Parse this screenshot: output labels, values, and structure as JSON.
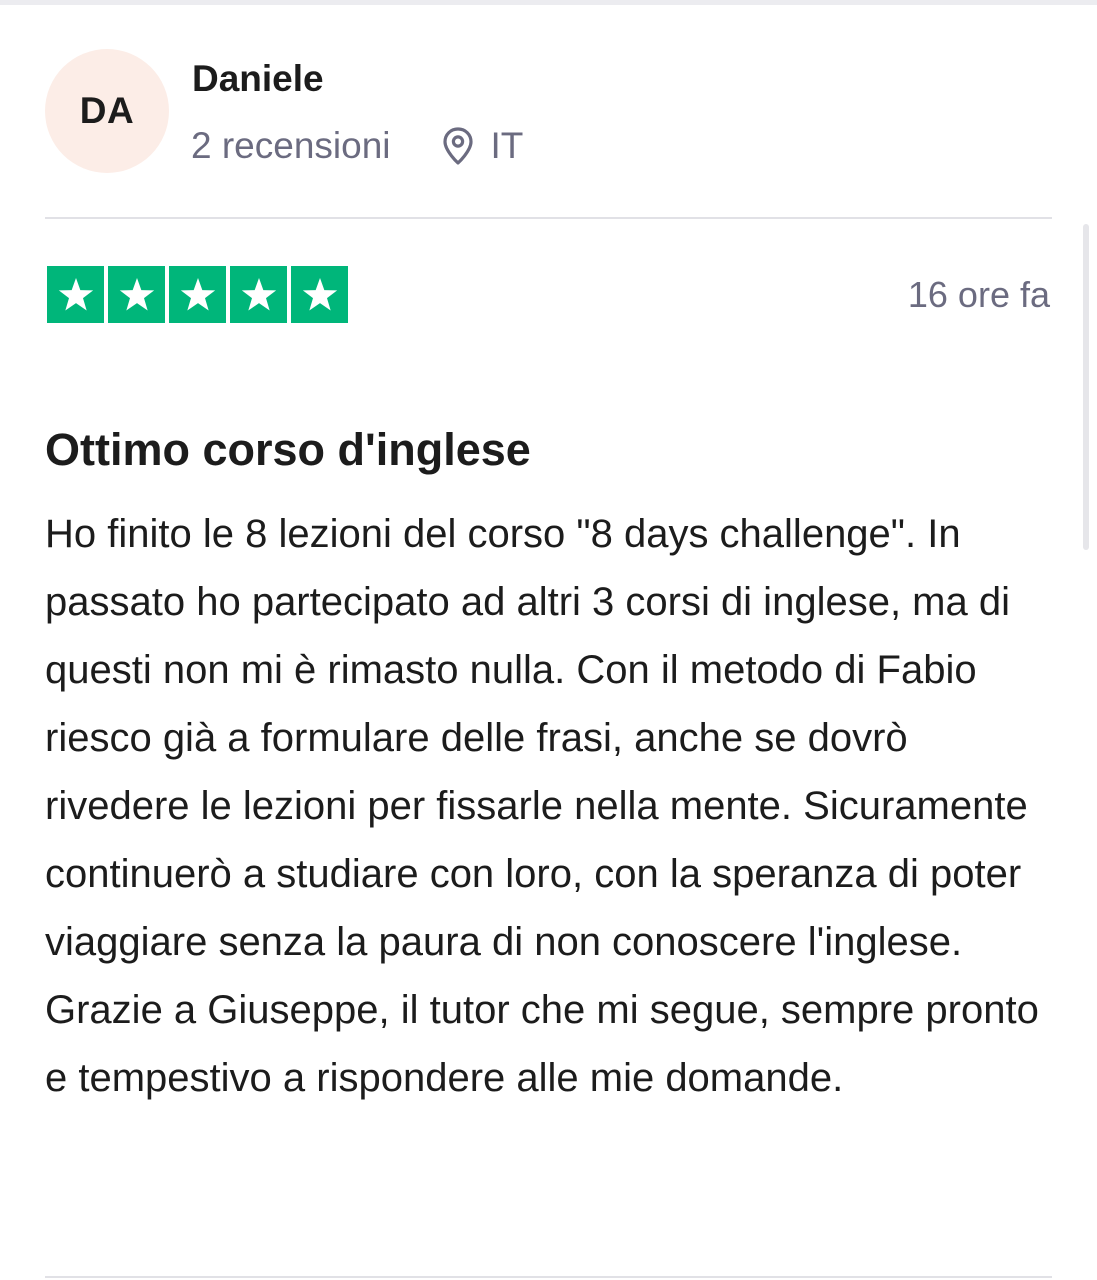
{
  "reviewer": {
    "initials": "DA",
    "name": "Daniele",
    "review_count": "2 recensioni",
    "country": "IT",
    "icon": "location-pin-icon"
  },
  "review": {
    "rating": 5,
    "rating_max": 5,
    "date": "16 ore fa",
    "title": "Ottimo corso d'inglese",
    "body": "Ho finito le 8 lezioni del corso \"8 days challenge\". In passato ho partecipato ad altri 3 corsi di inglese, ma di questi non mi è rimasto nulla. Con il metodo di Fabio riesco già a formulare delle frasi, anche se dovrò rivedere le lezioni per fissarle nella mente. Sicuramente continuerò a studiare con loro, con la speranza di poter viaggiare senza la paura di non conoscere l'inglese. Grazie a Giuseppe, il tutor che mi segue, sempre pronto e tempestivo a rispondere alle mie domande."
  },
  "colors": {
    "star_green": "#00b67a",
    "avatar_bg": "#fcede7",
    "muted_text": "#6b6b80",
    "divider": "#e1e1e6"
  }
}
